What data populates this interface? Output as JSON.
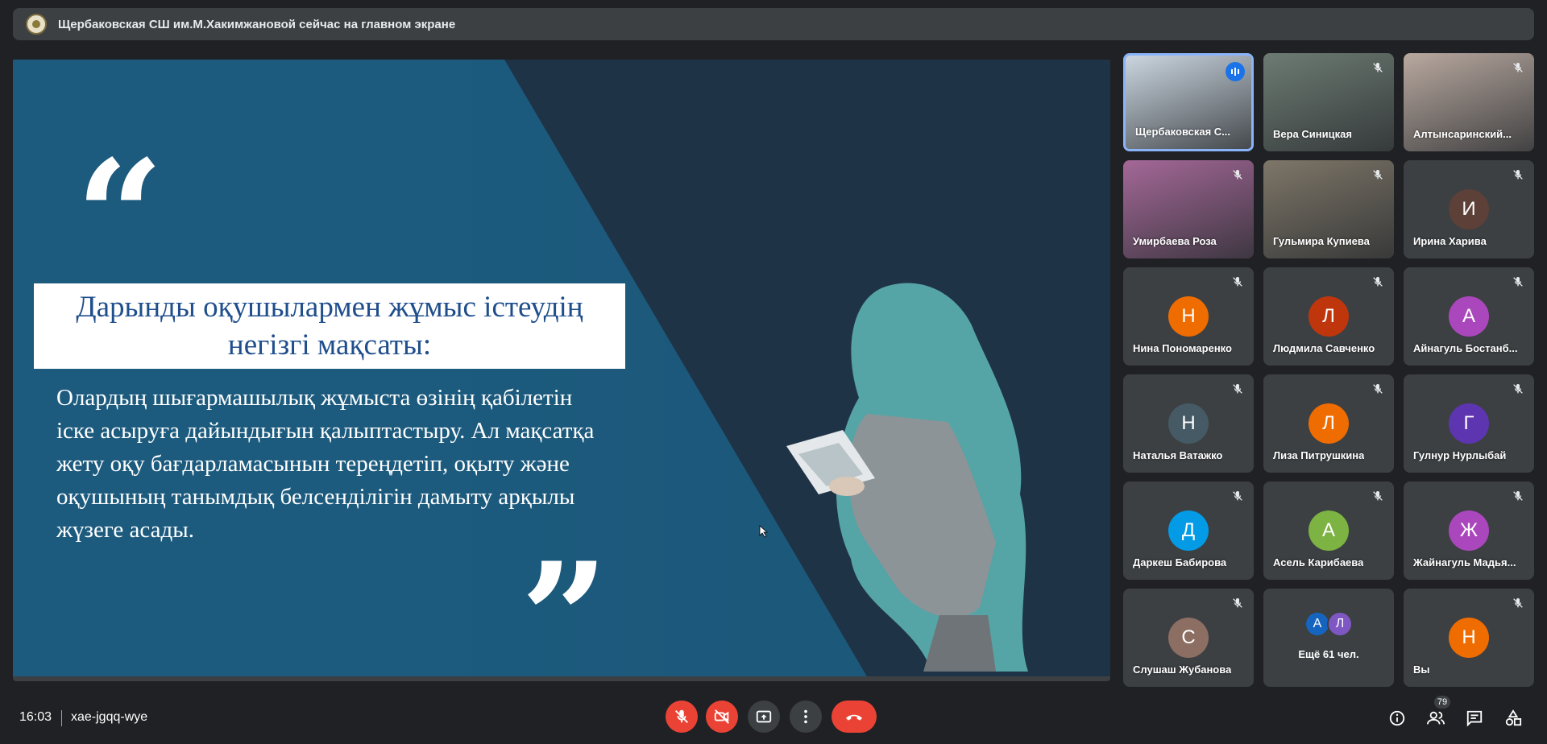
{
  "banner": {
    "text": "Щербаковская СШ им.М.Хакимжановой сейчас на главном экране",
    "logo_icon": "school-logo-icon"
  },
  "slide": {
    "title": "Дарынды оқушылармен жұмыс істеудің негізгі мақсаты:",
    "body": " Олардың шығармашылық жұмыста өзінің қабілетін іске асыруға дайындығын қалыптастыру. Ал мақсатқа жету оқу бағдарламасынын тереңдетіп, оқыту және оқушының танымдық белсенділігін дамыту арқылы жүзеге асады.",
    "quote_open": "“",
    "quote_close": "”"
  },
  "participants": [
    {
      "name": "Щербаковская С...",
      "type": "video",
      "speaking": true,
      "bg": "#cbd6e0"
    },
    {
      "name": "Вера Синицкая",
      "type": "video",
      "muted": true,
      "bg": "#6d7b73"
    },
    {
      "name": "Алтынсаринский...",
      "type": "video",
      "muted": true,
      "bg": "#b9a9a0"
    },
    {
      "name": "Умирбаева Роза",
      "type": "video",
      "muted": true,
      "bg": "#a46898"
    },
    {
      "name": "Гульмира Купиева",
      "type": "video",
      "muted": true,
      "bg": "#7e7668"
    },
    {
      "name": "Ирина Харива",
      "type": "avatar",
      "muted": true,
      "initial": "И",
      "color": "#5d4037"
    },
    {
      "name": "Нина Пономаренко",
      "type": "avatar",
      "muted": true,
      "initial": "Н",
      "color": "#ef6c00"
    },
    {
      "name": "Людмила Савченко",
      "type": "avatar",
      "muted": true,
      "initial": "Л",
      "color": "#bf360c"
    },
    {
      "name": "Айнагуль Бостанб...",
      "type": "avatar",
      "muted": true,
      "initial": "А",
      "color": "#ab47bc"
    },
    {
      "name": "Наталья Ватажко",
      "type": "avatar",
      "muted": true,
      "initial": "Н",
      "color": "#455a64"
    },
    {
      "name": "Лиза Питрушкина",
      "type": "avatar",
      "muted": true,
      "initial": "Л",
      "color": "#ef6c00"
    },
    {
      "name": "Гулнур Нурлыбай",
      "type": "avatar",
      "muted": true,
      "initial": "Г",
      "color": "#5e35b1"
    },
    {
      "name": "Даркеш Бабирова",
      "type": "avatar",
      "muted": true,
      "initial": "Д",
      "color": "#039be5"
    },
    {
      "name": "Асель Карибаева",
      "type": "avatar",
      "muted": true,
      "initial": "А",
      "color": "#7cb342"
    },
    {
      "name": "Жайнагуль Мадья...",
      "type": "avatar",
      "muted": true,
      "initial": "Ж",
      "color": "#ab47bc"
    },
    {
      "name": "Слушаш Жубанова",
      "type": "avatar",
      "muted": true,
      "initial": "С",
      "color": "#8d6e63"
    },
    {
      "name": "Ещё 61 чел.",
      "type": "more",
      "initials": [
        "А",
        "Л"
      ],
      "colors": [
        "#1565c0",
        "#7e57c2"
      ]
    },
    {
      "name": "Вы",
      "type": "avatar",
      "muted": true,
      "initial": "Н",
      "color": "#ef6c00"
    }
  ],
  "bottom": {
    "time": "16:03",
    "meeting_code": "xae-jgqq-wye",
    "people_count": "79",
    "controls": [
      "mic-off-icon",
      "camera-off-icon",
      "present-icon",
      "more-vert-icon",
      "hang-up-icon"
    ],
    "right_icons": [
      "info-icon",
      "people-icon",
      "chat-icon",
      "activities-icon"
    ]
  },
  "colors": {
    "background": "#202124",
    "tile": "#3c4043",
    "danger": "#ea4335",
    "accent": "#8ab4f8"
  }
}
